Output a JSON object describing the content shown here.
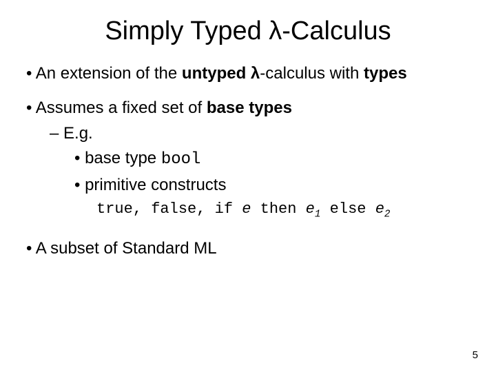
{
  "title_parts": {
    "before": "Simply Typed ",
    "lambda": "λ",
    "after": "-Calculus"
  },
  "bullets": {
    "p1": {
      "a": "An extension of the ",
      "b": "untyped ",
      "c": "λ",
      "d": "-calculus with ",
      "e": "types"
    },
    "p2": {
      "a": "Assumes a fixed set of ",
      "b": "base types"
    },
    "eg": "E.g.",
    "bt": {
      "a": "base type  ",
      "b": "bool"
    },
    "pc": "primitive constructs",
    "codeline": {
      "true": "true",
      "c1": ", ",
      "false": "false",
      "c2": ", ",
      "if": "if ",
      "e": " e ",
      "then": "then ",
      "e1": " e",
      "e1sub": "1",
      "else": " else ",
      "e2": " e",
      "e2sub": "2"
    },
    "p3": "A subset of Standard ML"
  },
  "slide_number": "5"
}
